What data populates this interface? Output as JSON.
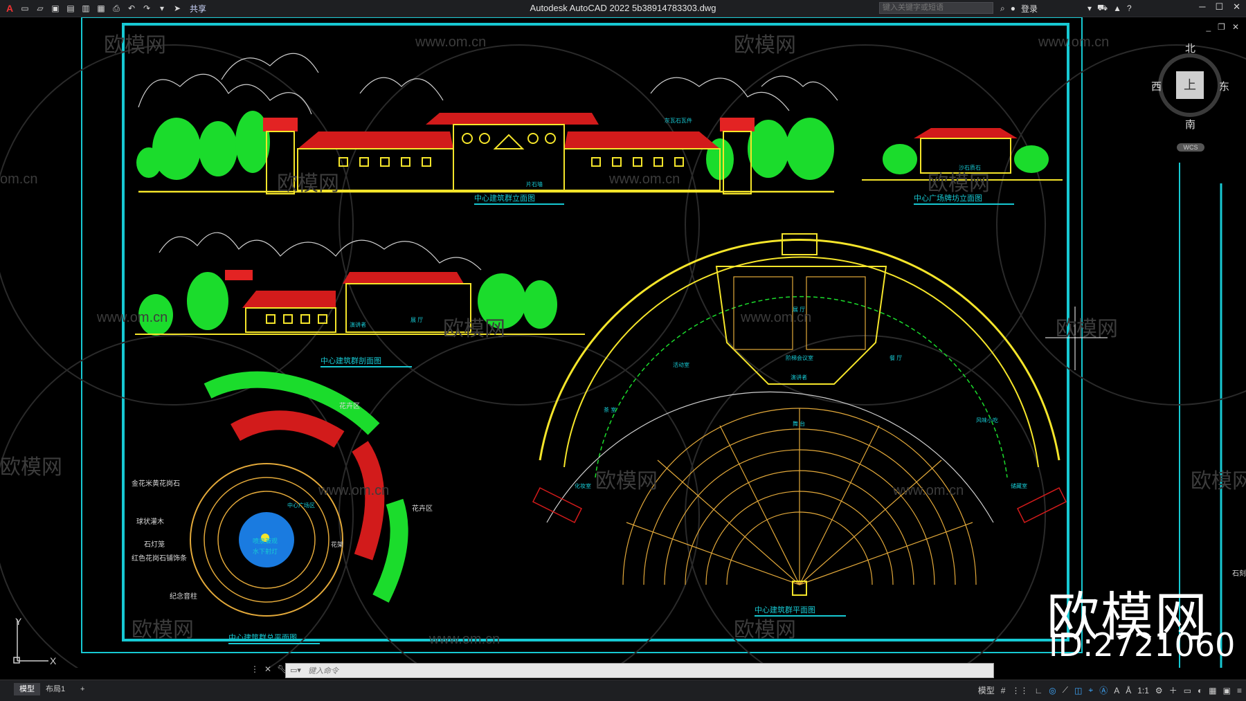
{
  "window": {
    "title": "Autodesk AutoCAD 2022    5b38914783303.dwg"
  },
  "quick_access": {
    "share": "共享"
  },
  "search": {
    "placeholder": "键入关键字或短语"
  },
  "user": {
    "login": "登录"
  },
  "viewcube": {
    "north": "北",
    "south": "南",
    "east": "东",
    "west": "西",
    "face": "上",
    "wcs": "WCS"
  },
  "drawing_labels": {
    "elevation": "中心建筑群立面图",
    "plaza_elevation": "中心广场牌坊立面图",
    "section": "中心建筑群剖面图",
    "site_plan": "中心建筑群总平面图",
    "floor_plan": "中心建筑群平面图",
    "gate_note": "片石墙",
    "roof_note": "灰瓦石瓦件",
    "paifang_note": "沙石质石",
    "section_room1": "演讲者",
    "section_room2": "展 厅",
    "flower1": "花卉区",
    "flower2": "花卉区",
    "leg1": "金花米黄花岗石",
    "leg2": "球状灌木",
    "leg3": "石灯笼",
    "leg4": "红色花岗石铺饰条",
    "leg5": "纪念音柱",
    "center_square": "中心广场区",
    "fountain": "喷泉兼观",
    "water": "水下射灯",
    "flower_bed": "花架",
    "room_west": "活动室",
    "room_east": "餐 厅",
    "room_north": "展 厅",
    "room_far_west": "茶 室",
    "room_far_east": "风味小吃",
    "meeting": "阶梯会议室",
    "speech": "演讲者",
    "stage": "舞 台",
    "dressing": "化妆室",
    "dressing2": "储藏室",
    "edge_text": "石刻"
  },
  "watermark": {
    "brand": "欧模网",
    "url": "www.om.cn",
    "short": "om.cn"
  },
  "brand": {
    "name": "欧模网",
    "id": "ID:2721060"
  },
  "command": {
    "placeholder": "键入命令"
  },
  "layout_tabs": [
    "模型",
    "布局1",
    "+"
  ],
  "status": {
    "model": "模型",
    "scale": "1:1"
  },
  "ucs": {
    "y": "Y",
    "x": "X"
  }
}
